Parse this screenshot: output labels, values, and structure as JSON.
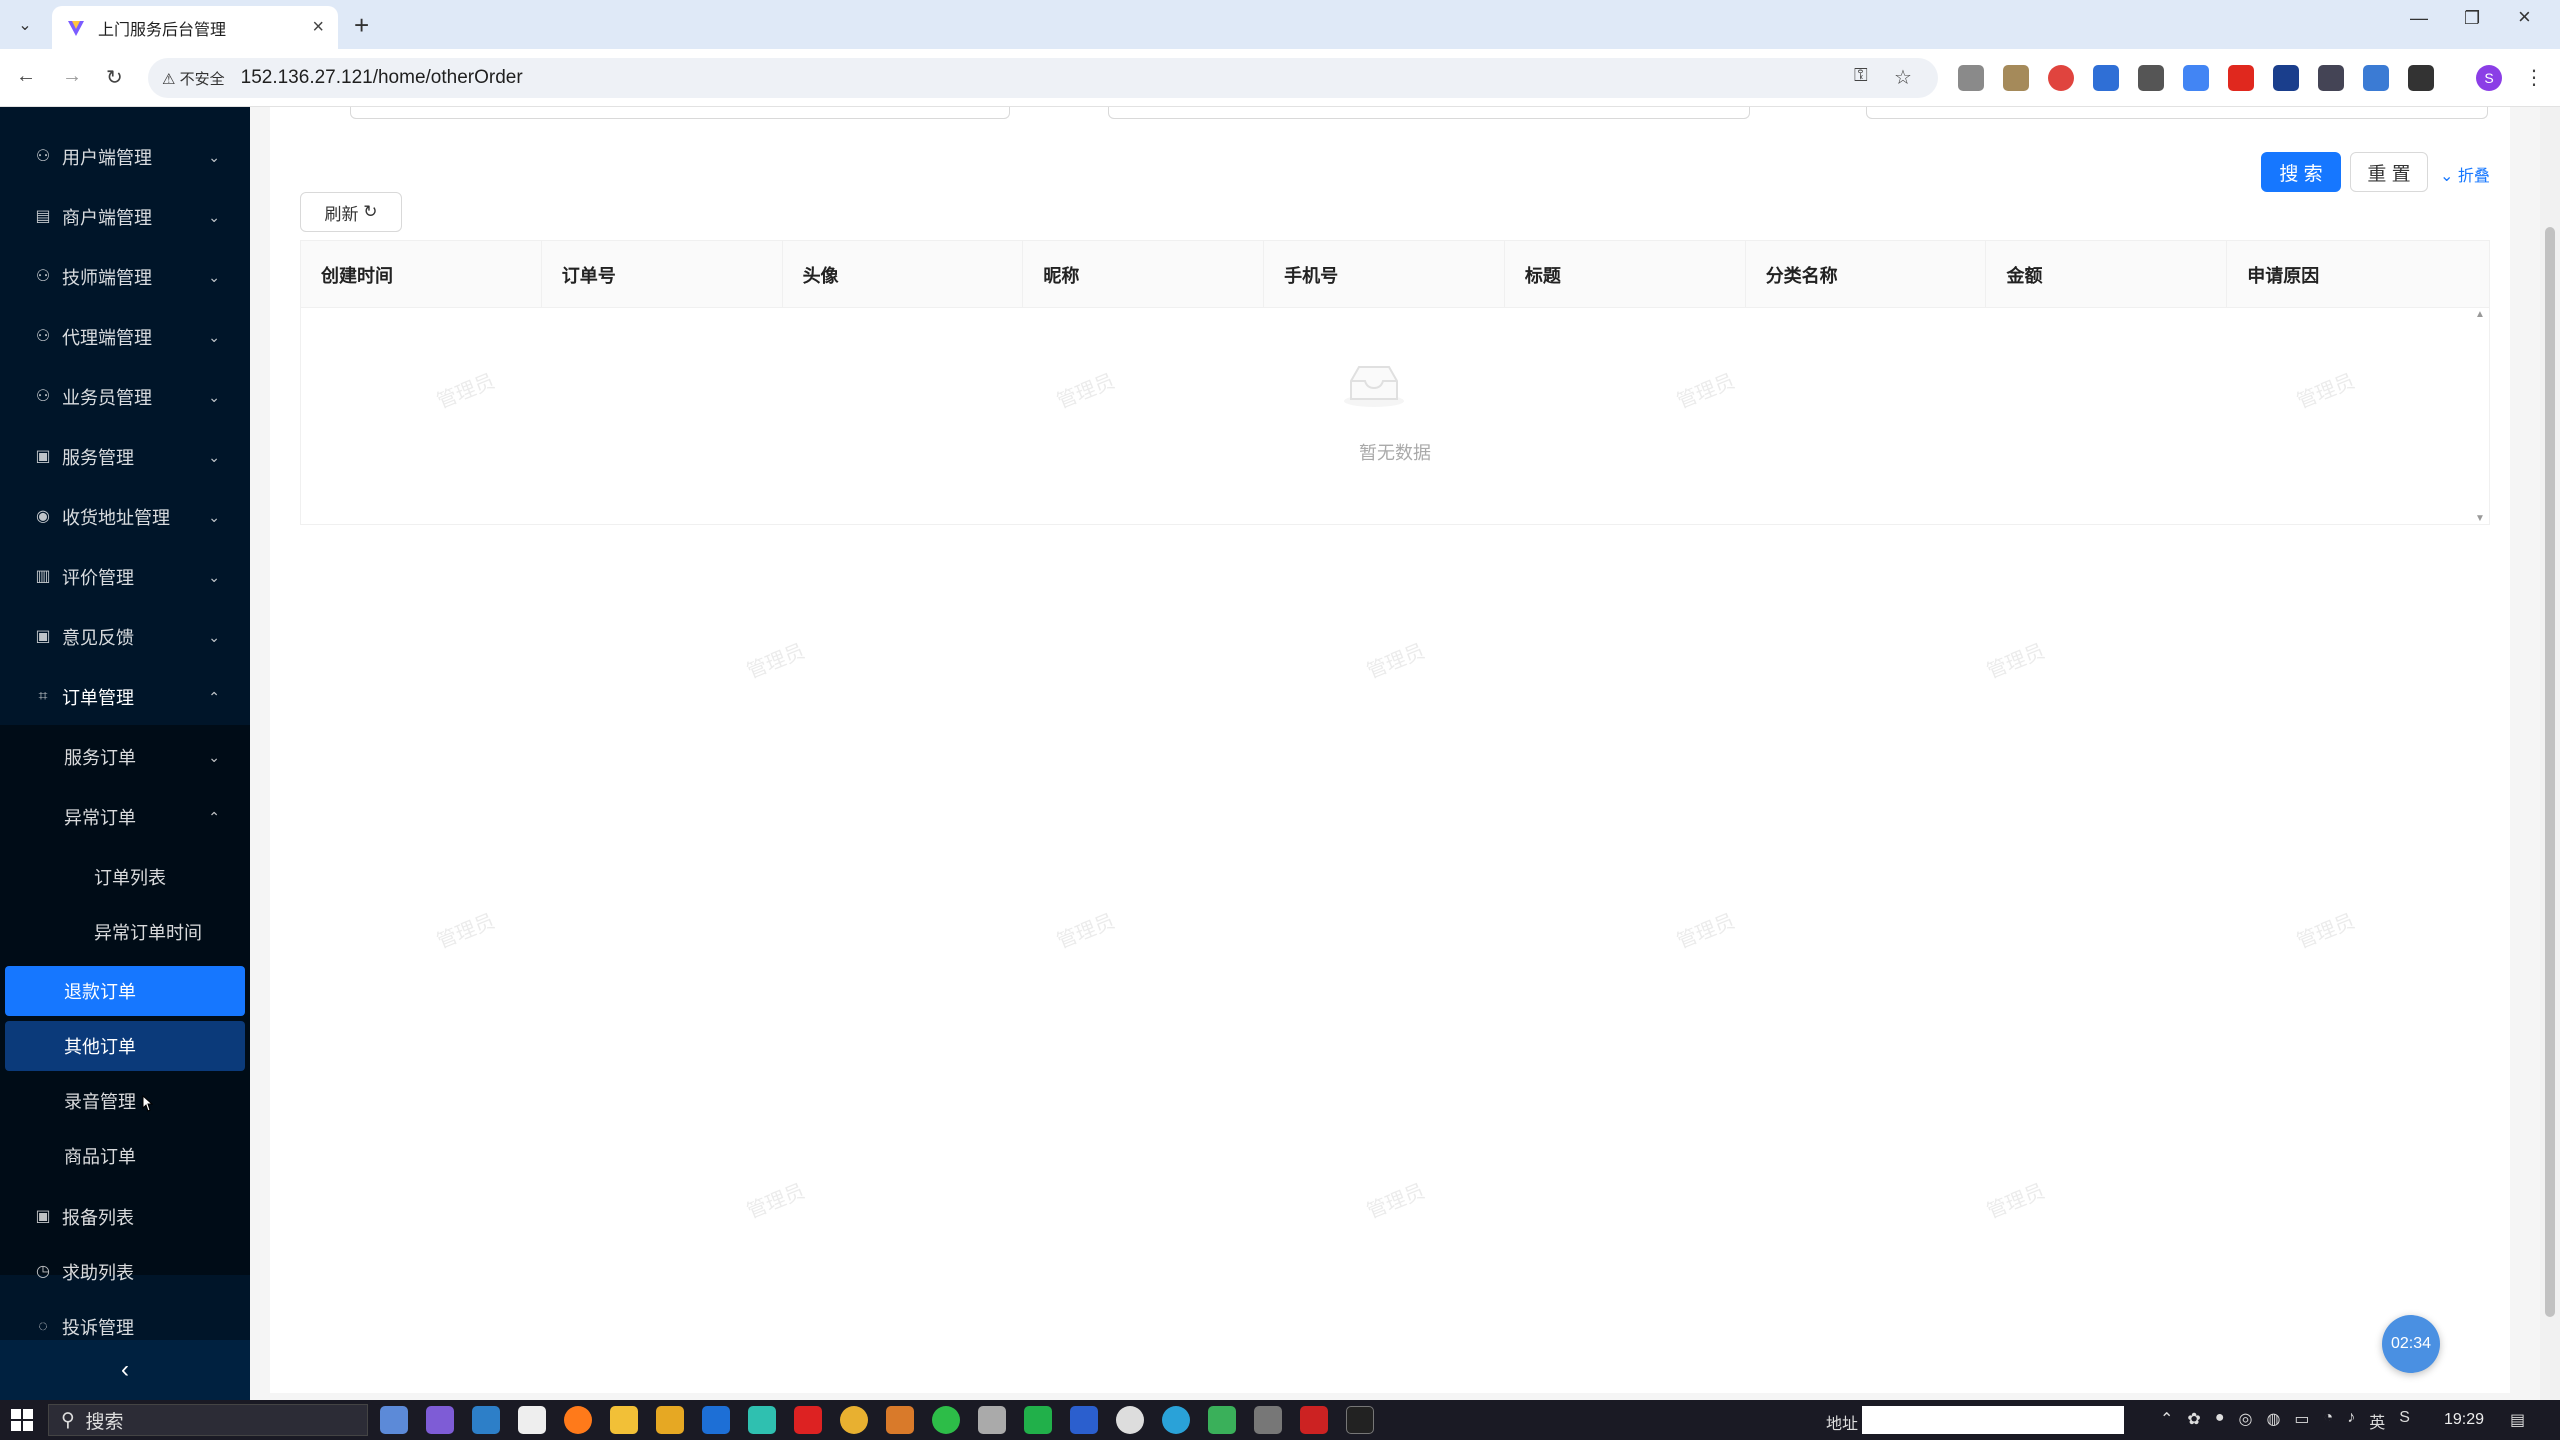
{
  "browser": {
    "tab_title": "上门服务后台管理",
    "security_label": "不安全",
    "url": "152.136.27.121/home/otherOrder",
    "profile_initial": "S"
  },
  "sidebar": {
    "items": [
      {
        "label": "用户端管理",
        "icon": "user-icon"
      },
      {
        "label": "商户端管理",
        "icon": "shop-icon"
      },
      {
        "label": "技师端管理",
        "icon": "user-icon"
      },
      {
        "label": "代理端管理",
        "icon": "user-icon"
      },
      {
        "label": "业务员管理",
        "icon": "user-icon"
      },
      {
        "label": "服务管理",
        "icon": "file-icon"
      },
      {
        "label": "收货地址管理",
        "icon": "location-icon"
      },
      {
        "label": "评价管理",
        "icon": "comment-icon"
      },
      {
        "label": "意见反馈",
        "icon": "file-icon"
      },
      {
        "label": "订单管理",
        "icon": "order-icon"
      }
    ],
    "order_sub": {
      "service_orders": "服务订单",
      "abnormal_orders": "异常订单",
      "order_list": "订单列表",
      "abnormal_time": "异常订单时间",
      "refund_orders": "退款订单",
      "other_orders": "其他订单",
      "recording": "录音管理",
      "product_orders": "商品订单"
    },
    "bottom_items": [
      {
        "label": "报备列表",
        "icon": "file-icon"
      },
      {
        "label": "求助列表",
        "icon": "help-icon"
      },
      {
        "label": "投诉管理",
        "icon": "complaint-icon"
      }
    ]
  },
  "search": {
    "search_label": "搜 索",
    "reset_label": "重 置",
    "collapse_label": "折叠"
  },
  "refresh_label": "刷新",
  "table": {
    "columns": [
      "创建时间",
      "订单号",
      "头像",
      "昵称",
      "手机号",
      "标题",
      "分类名称",
      "金额",
      "申请原因"
    ],
    "empty_text": "暂无数据"
  },
  "watermark": "管理员",
  "timer": "02:34",
  "taskbar": {
    "search_label": "搜索",
    "address_label": "地址",
    "ime": "英",
    "time": "19:29"
  }
}
